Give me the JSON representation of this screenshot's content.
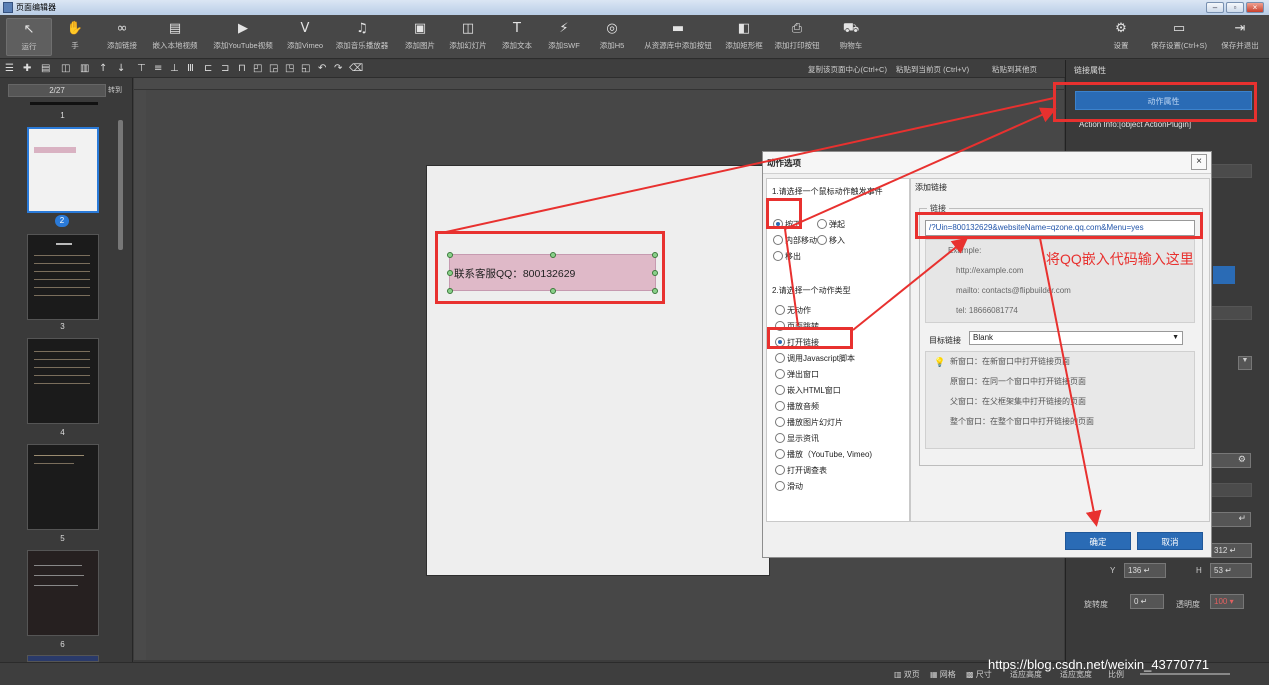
{
  "window": {
    "title": "页面编辑器"
  },
  "toolbar": {
    "run": "运行",
    "hand": "手",
    "add_link": "添加链接",
    "embed_video": "嵌入本地视频",
    "add_youtube": "添加YouTube视频",
    "add_vimeo": "添加Vimeo",
    "add_audio": "添加音乐播放器",
    "add_image": "添加图片",
    "add_slideshow": "添加幻灯片",
    "add_text": "添加文本",
    "add_swf": "添加SWF",
    "add_html5": "添加H5",
    "add_from_lib": "从资源库中添加按钮",
    "add_shape": "添加矩形框",
    "add_print": "添加打印按钮",
    "cart": "购物车",
    "settings": "设置",
    "save_settings": "保存设置(Ctrl+S)",
    "save_exit": "保存并退出"
  },
  "subbar": {
    "copy": "复制该页面中心(Ctrl+C)",
    "paste": "粘贴到当前页 (Ctrl+V)",
    "paste_other": "粘贴到其他页"
  },
  "pages": {
    "counter": "2/27",
    "go": "转到",
    "labels": [
      "1",
      "2",
      "3",
      "4",
      "5",
      "6"
    ]
  },
  "canvas": {
    "textbox_text": "联系客服QQ：800132629"
  },
  "right_panel": {
    "title": "链接属性",
    "action_button": "动作属性",
    "action_info": "Action Info:[object ActionPlugin]"
  },
  "dialog": {
    "title": "动作选项",
    "close": "×",
    "section1": "1.请选择一个鼠标动作触发事件",
    "mouse_events": [
      {
        "label": "按下",
        "selected": true
      },
      {
        "label": "弹起",
        "selected": false
      },
      {
        "label": "内部移动",
        "selected": false
      },
      {
        "label": "移入",
        "selected": false
      },
      {
        "label": "移出",
        "selected": false
      }
    ],
    "section2": "2.请选择一个动作类型",
    "action_types": [
      {
        "label": "无动作",
        "selected": false
      },
      {
        "label": "页面跳转",
        "selected": false
      },
      {
        "label": "打开链接",
        "selected": true
      },
      {
        "label": "调用Javascript脚本",
        "selected": false
      },
      {
        "label": "弹出窗口",
        "selected": false
      },
      {
        "label": "嵌入HTML窗口",
        "selected": false
      },
      {
        "label": "播放音频",
        "selected": false
      },
      {
        "label": "播放图片幻灯片",
        "selected": false
      },
      {
        "label": "显示资讯",
        "selected": false
      },
      {
        "label": "播放（YouTube, Vimeo)",
        "selected": false
      },
      {
        "label": "打开调查表",
        "selected": false
      },
      {
        "label": "滑动",
        "selected": false
      }
    ],
    "tab": "添加链接",
    "link_group": "链接",
    "url_value": "/?Uin=800132629&websiteName=qzone.qq.com&Menu=yes",
    "examples": [
      "Example:",
      "http://example.com",
      "mailto: contacts@flipbuilder.com",
      "tel: 18666081774"
    ],
    "target_label": "目标链接",
    "target_value": "Blank",
    "target_arrow": "▼",
    "hints": [
      "新窗口：在新窗口中打开链接页面",
      "原窗口：在同一个窗口中打开链接页面",
      "父窗口：在父框架集中打开链接的页面",
      "整个窗口：在整个窗口中打开链接的页面"
    ],
    "ok": "确定",
    "cancel": "取消"
  },
  "annotation": "将QQ嵌入代码输入这里",
  "statusbar": {
    "double_page": "双页",
    "grid": "网格",
    "zoom_label": "尺寸",
    "items": [
      "适应高度",
      "适应宽度",
      "比例"
    ]
  },
  "right_props": {
    "w_value": "312",
    "y_label": "Y",
    "y_value": "136",
    "h_label": "H",
    "h_value": "53",
    "rotate_label": "旋转度",
    "rotate_value": "0",
    "opacity_label": "透明度",
    "opacity_value": "100"
  },
  "watermark": "https://blog.csdn.net/weixin_43770771"
}
